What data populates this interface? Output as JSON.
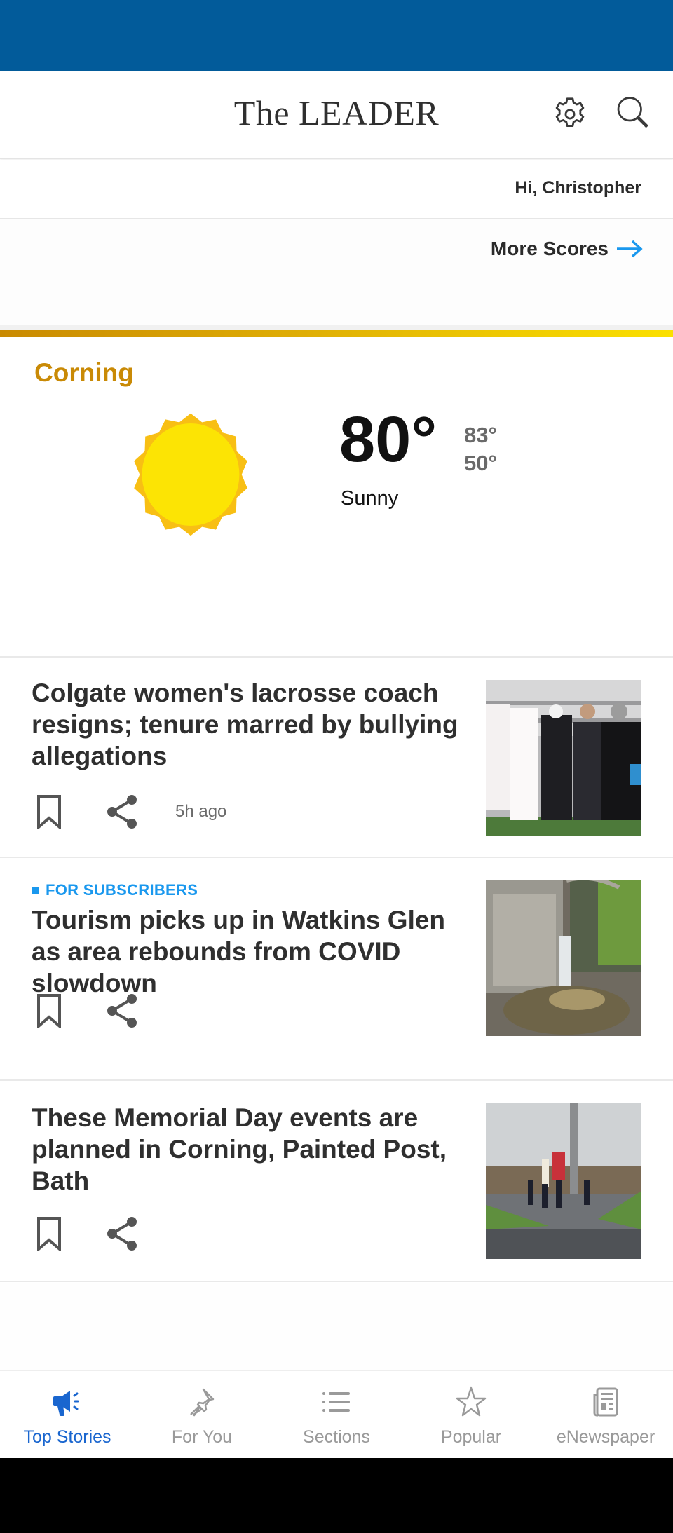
{
  "header": {
    "title": "The LEADER",
    "settings_icon": "gear-icon",
    "search_icon": "search-icon"
  },
  "greeting": "Hi, Christopher",
  "scores": {
    "more_label": "More Scores",
    "arrow_icon": "arrow-right-icon",
    "arrow_color": "#1a98ee"
  },
  "weather": {
    "city": "Corning",
    "icon": "sun-icon",
    "temperature": "80°",
    "high": "83°",
    "low": "50°",
    "condition": "Sunny",
    "accent_color": "#c98a06"
  },
  "articles": [
    {
      "tag": "",
      "headline": "Colgate women's lacrosse coach resigns; tenure marred by bullying allegations",
      "time": "5h ago",
      "image_desc": "lacrosse players and coach on field"
    },
    {
      "tag": "FOR SUBSCRIBERS",
      "headline": "Tourism picks up in Watkins Glen as area rebounds from COVID slowdown",
      "time": "",
      "image_desc": "waterfall in gorge"
    },
    {
      "tag": "",
      "headline": "These Memorial Day events are planned in Corning, Painted Post, Bath",
      "time": "",
      "image_desc": "color guard marching with flags"
    }
  ],
  "bottom_nav": {
    "items": [
      {
        "label": "Top Stories",
        "icon": "megaphone-icon",
        "active": true
      },
      {
        "label": "For You",
        "icon": "pushpin-icon",
        "active": false
      },
      {
        "label": "Sections",
        "icon": "list-icon",
        "active": false
      },
      {
        "label": "Popular",
        "icon": "star-icon",
        "active": false
      },
      {
        "label": "eNewspaper",
        "icon": "newspaper-icon",
        "active": false
      }
    ],
    "active_color": "#1a66cf",
    "inactive_color": "#9a9a9a"
  },
  "colors": {
    "brand_blue": "#025b9a",
    "subscriber_blue": "#1a98ee"
  }
}
